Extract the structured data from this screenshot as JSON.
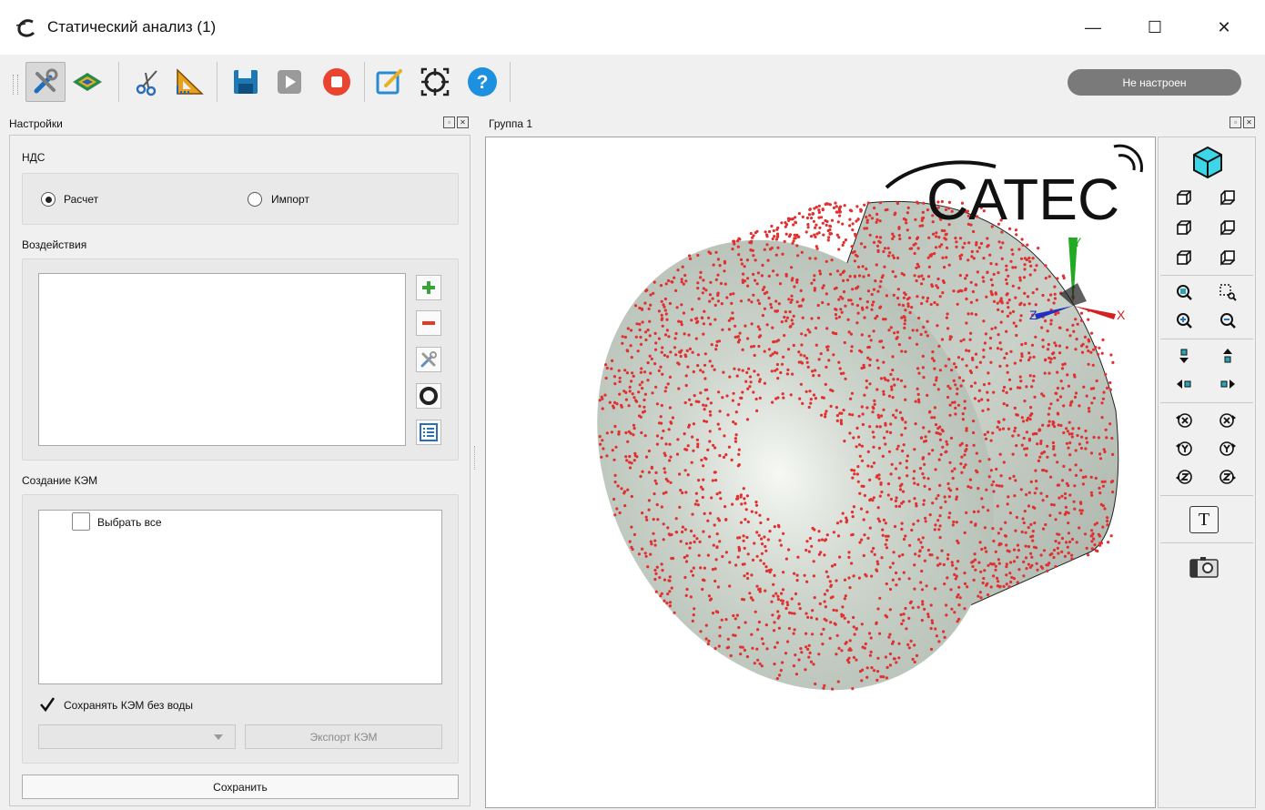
{
  "window": {
    "title": "Статический анализ (1)",
    "controls": {
      "minimize": "—",
      "maximize": "☐",
      "close": "✕"
    }
  },
  "toolbar": {
    "status": "Не настроен",
    "buttons": [
      "settings-icon",
      "mesh-surface-icon",
      "scissors-icon",
      "triangle-ruler-icon",
      "save-icon",
      "play-icon",
      "stop-icon",
      "edit-icon",
      "target-icon",
      "help-icon"
    ]
  },
  "settings_panel": {
    "title": "Настройки",
    "nds": {
      "label": "НДС",
      "options": [
        {
          "label": "Расчет",
          "selected": true
        },
        {
          "label": "Импорт",
          "selected": false
        }
      ]
    },
    "impacts": {
      "label": "Воздействия"
    },
    "kem": {
      "label": "Создание КЭМ",
      "select_all": "Выбрать все",
      "save_without_water": "Сохранять КЭМ без воды",
      "save_without_water_checked": true,
      "export_button": "Экспорт КЭМ"
    },
    "save_button": "Сохранить"
  },
  "viewport": {
    "title": "Группа 1",
    "logo_text": "CATEC",
    "axes": {
      "x": "X",
      "y": "Y",
      "z": "Z"
    },
    "colors": {
      "nodes": "#e03030",
      "surface": "#c6cfc6",
      "x_axis": "#d42020",
      "y_axis": "#20b020",
      "z_axis": "#2030c0"
    }
  },
  "view_toolbar": {
    "text_toggle": "T"
  }
}
